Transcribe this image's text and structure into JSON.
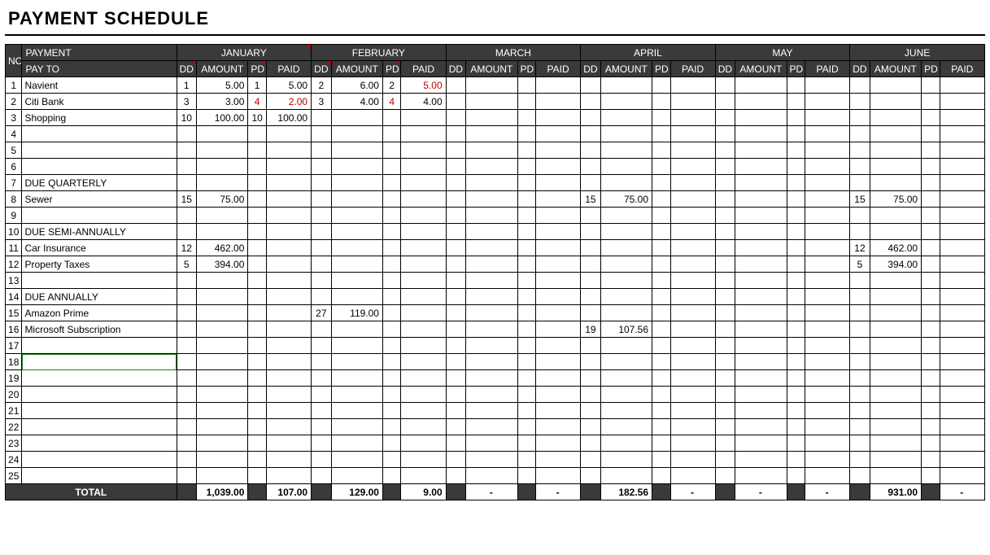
{
  "title": "PAYMENT SCHEDULE",
  "labels": {
    "no": "NO",
    "payment": "PAYMENT",
    "payto": "PAY TO",
    "dd": "DD",
    "amount": "AMOUNT",
    "pd": "PD",
    "paid": "PAID",
    "total": "TOTAL"
  },
  "months": [
    "JANUARY",
    "FEBRUARY",
    "MARCH",
    "APRIL",
    "MAY",
    "JUNE"
  ],
  "rowCount": 25,
  "rows": {
    "1": {
      "payto": "Navient",
      "m": [
        {
          "dd": "1",
          "amount": "5.00",
          "pd": "1",
          "paid": "5.00"
        },
        {
          "dd": "2",
          "amount": "6.00",
          "pd": "2",
          "paid": "5.00",
          "paidRed": true
        },
        {},
        {},
        {},
        {}
      ]
    },
    "2": {
      "payto": "Citi Bank",
      "m": [
        {
          "dd": "3",
          "amount": "3.00",
          "pd": "4",
          "pdRed": true,
          "paid": "2.00",
          "paidRed": true
        },
        {
          "dd": "3",
          "amount": "4.00",
          "pd": "4",
          "pdRed": true,
          "paid": "4.00"
        },
        {},
        {},
        {},
        {}
      ]
    },
    "3": {
      "payto": "Shopping",
      "m": [
        {
          "dd": "10",
          "amount": "100.00",
          "pd": "10",
          "paid": "100.00"
        },
        {},
        {},
        {},
        {},
        {}
      ]
    },
    "7": {
      "payto": "DUE QUARTERLY"
    },
    "8": {
      "payto": "Sewer",
      "m": [
        {
          "dd": "15",
          "amount": "75.00"
        },
        {},
        {},
        {
          "dd": "15",
          "amount": "75.00"
        },
        {},
        {
          "dd": "15",
          "amount": "75.00"
        }
      ]
    },
    "10": {
      "payto": "DUE SEMI-ANNUALLY"
    },
    "11": {
      "payto": "Car Insurance",
      "m": [
        {
          "dd": "12",
          "amount": "462.00"
        },
        {},
        {},
        {},
        {},
        {
          "dd": "12",
          "amount": "462.00"
        }
      ]
    },
    "12": {
      "payto": "Property Taxes",
      "m": [
        {
          "dd": "5",
          "amount": "394.00"
        },
        {},
        {},
        {},
        {},
        {
          "dd": "5",
          "amount": "394.00"
        }
      ]
    },
    "14": {
      "payto": "DUE ANNUALLY"
    },
    "15": {
      "payto": "Amazon Prime",
      "m": [
        {},
        {
          "dd": "27",
          "amount": "119.00"
        },
        {},
        {},
        {},
        {}
      ]
    },
    "16": {
      "payto": "Microsoft Subscription",
      "m": [
        {},
        {},
        {},
        {
          "dd": "19",
          "amount": "107.56"
        },
        {},
        {}
      ]
    }
  },
  "totals": [
    {
      "amount": "1,039.00",
      "paid": "107.00"
    },
    {
      "amount": "129.00",
      "paid": "9.00"
    },
    {
      "amount": "-",
      "paid": "-"
    },
    {
      "amount": "182.56",
      "paid": "-"
    },
    {
      "amount": "-",
      "paid": "-"
    },
    {
      "amount": "931.00",
      "paid": "-"
    }
  ],
  "noteCells": [
    "jan-dd",
    "jan-pd",
    "feb-dd",
    "feb-pd"
  ],
  "selectedCell": {
    "row": 18,
    "col": "payto"
  }
}
